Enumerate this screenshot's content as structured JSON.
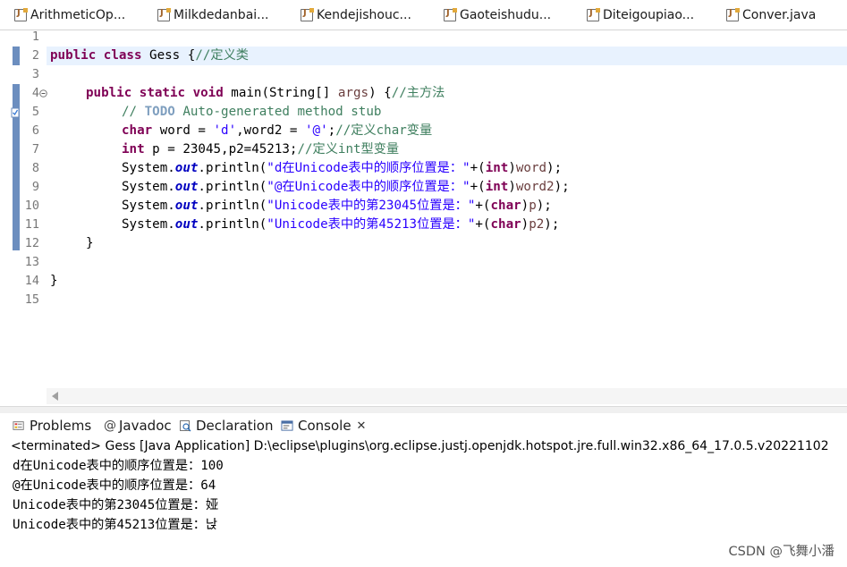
{
  "editor_tabs": [
    {
      "label": "ArithmeticOp..."
    },
    {
      "label": "Milkdedanbai..."
    },
    {
      "label": "Kendejishouc..."
    },
    {
      "label": "Gaoteishudu..."
    },
    {
      "label": "Diteigoupiao..."
    },
    {
      "label": "Conver.java"
    }
  ],
  "line_numbers": [
    "1",
    "2",
    "3",
    "4",
    "5",
    "6",
    "7",
    "8",
    "9",
    "10",
    "11",
    "12",
    "13",
    "14",
    "15"
  ],
  "code": {
    "l2_kw1": "public",
    "l2_kw2": "class",
    "l2_name": " Gess {",
    "l2_cm": "//定义类",
    "l4_kw1": "public",
    "l4_kw2": "static",
    "l4_kw3": "void",
    "l4_rest": " main(String[] ",
    "l4_var": "args",
    "l4_rest2": ") {",
    "l4_cm": "//主方法",
    "l5_cm1": "// ",
    "l5_todo": "TODO",
    "l5_cm2": " Auto-generated method stub",
    "l6_kw": "char",
    "l6_a": " word = ",
    "l6_s1": "'d'",
    "l6_b": ",word2 = ",
    "l6_s2": "'@'",
    "l6_c": ";",
    "l6_cm": "//定义char变量",
    "l7_kw": "int",
    "l7_a": " p = 23045,p2=45213;",
    "l7_cm": "//定义int型变量",
    "sys": "System.",
    "out": "out",
    "println": ".println(",
    "l8_s": "\"d在Unicode表中的顺序位置是：\"",
    "l8_plus": "+(",
    "l8_kw": "int",
    "l8_close": ")",
    "l8_var": "word",
    "l8_end": ");",
    "l9_s": "\"@在Unicode表中的顺序位置是：\"",
    "l9_plus": "+(",
    "l9_kw": "int",
    "l9_close": ")",
    "l9_var": "word2",
    "l9_end": ");",
    "l10_s": "\"Unicode表中的第23045位置是：\"",
    "l10_plus": "+(",
    "l10_kw": "char",
    "l10_close": ")",
    "l10_var": "p",
    "l10_end": ");",
    "l11_s": "\"Unicode表中的第45213位置是：\"",
    "l11_plus": "+(",
    "l11_kw": "char",
    "l11_close": ")",
    "l11_var": "p2",
    "l11_end": ");",
    "l12": "}",
    "l14": "}"
  },
  "panel_tabs": {
    "problems": "Problems",
    "javadoc": "Javadoc",
    "declaration": "Declaration",
    "console": "Console",
    "close": "✕"
  },
  "console": {
    "status": "<terminated> Gess [Java Application] D:\\eclipse\\plugins\\org.eclipse.justj.openjdk.hotspot.jre.full.win32.x86_64_17.0.5.v20221102",
    "lines": [
      "d在Unicode表中的顺序位置是：100",
      "@在Unicode表中的顺序位置是：64",
      "Unicode表中的第23045位置是：娅",
      "Unicode表中的第45213位置是：낝"
    ]
  },
  "watermark": "CSDN @飞舞小潘",
  "colors": {
    "keyword": "#7f0055",
    "comment": "#3f7f5f",
    "string": "#2a00ff",
    "field": "#0000c0",
    "current_line": "#e8f2fe"
  }
}
